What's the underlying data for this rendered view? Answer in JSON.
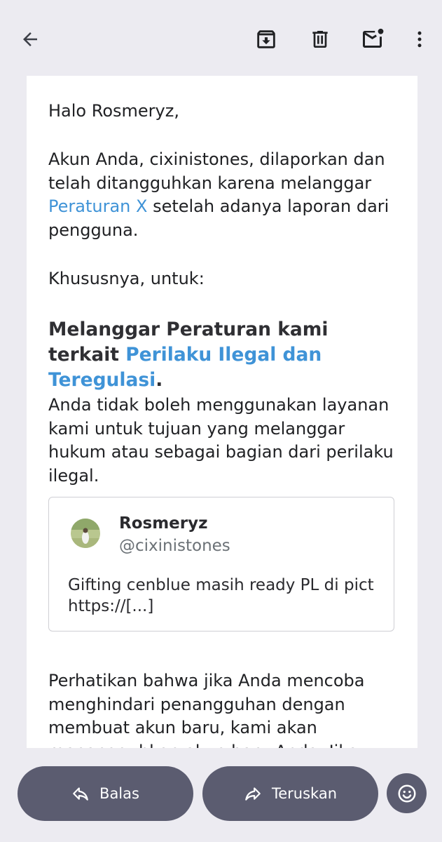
{
  "toolbar": {
    "back_icon": "arrow-left-icon",
    "archive_icon": "archive-icon",
    "delete_icon": "trash-icon",
    "mark_unread_icon": "mail-unread-icon",
    "more_icon": "more-vertical-icon"
  },
  "email": {
    "greeting": "Halo Rosmeryz,",
    "p1_part1": "Akun Anda, cixinistones, dilaporkan dan telah ditangguhkan karena melanggar ",
    "p1_link": "Peraturan X",
    "p1_part2": " setelah adanya laporan dari pengguna.",
    "p2": "Khususnya, untuk:",
    "heading_part1": "Melanggar Peraturan kami terkait ",
    "heading_link": "Perilaku Ilegal dan Teregulasi",
    "heading_part2": ".",
    "p3": "Anda tidak boleh menggunakan layanan kami untuk tujuan yang melanggar hukum atau sebagai bagian dari perilaku ilegal.",
    "tweet": {
      "name": "Rosmeryz",
      "handle": "@cixinistones",
      "text": "Gifting cenblue masih ready PL di pict https://[...]"
    },
    "p4": "Perhatikan bahwa jika Anda mencoba menghindari penangguhan dengan membuat akun baru, kami akan menangguhkan akun baru Anda. Jika"
  },
  "actions": {
    "reply_label": "Balas",
    "forward_label": "Teruskan",
    "reply_icon": "reply-icon",
    "forward_icon": "forward-icon",
    "emoji_icon": "emoji-icon"
  },
  "colors": {
    "link": "#3f93d7",
    "pill": "#5b5c70",
    "background": "#ecebf1"
  }
}
